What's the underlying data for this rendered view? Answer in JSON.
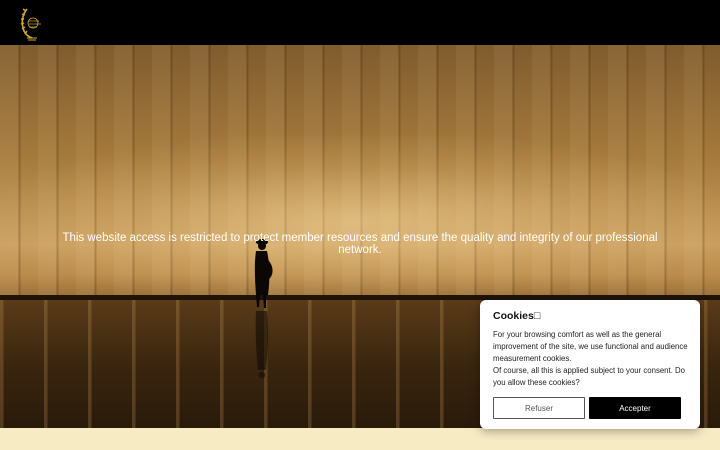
{
  "header": {
    "logo_icon": "laurel-wreath-logo-icon",
    "logo_colors": {
      "gold": "#d4a82a"
    }
  },
  "hero": {
    "message": "This website access is restricted to protect member resources and ensure the quality and integrity of our professional network."
  },
  "cookie_banner": {
    "title": "Cookies",
    "title_icon": "cookie-glyph-icon",
    "body_line1": "For your browsing comfort as well as the general improvement of the site, we use functional and audience measurement cookies.",
    "body_line2": "Of course, all this is applied subject to your consent. Do you allow these cookies?",
    "refuse_label": "Refuser",
    "accept_label": "Accepter"
  },
  "accessibility": {
    "icon": "accessibility-icon"
  },
  "colors": {
    "accept_bg": "#000000",
    "footer_strip": "#f7ebc4",
    "a11y_badge": "#1d3f8f"
  }
}
